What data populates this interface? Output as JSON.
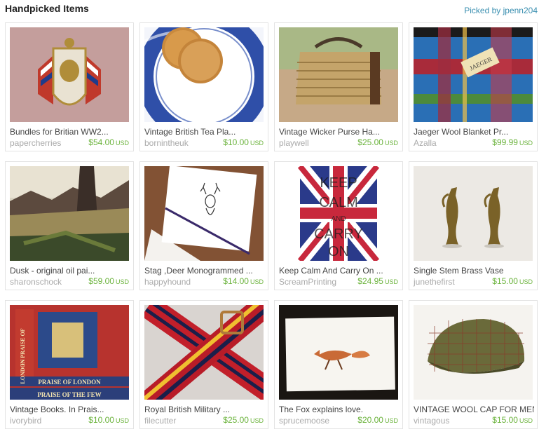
{
  "header": {
    "title": "Handpicked Items",
    "picked_by": "Picked by jpenn204"
  },
  "items": [
    {
      "title": "Bundles for Britian WW2...",
      "seller": "papercherries",
      "price": "$54.00",
      "currency": "USD",
      "image": "lion-crest-brooch"
    },
    {
      "title": "Vintage British Tea Pla...",
      "seller": "bornintheuk",
      "price": "$10.00",
      "currency": "USD",
      "image": "blue-willow-plate-biscuits"
    },
    {
      "title": "Vintage Wicker Purse Ha...",
      "seller": "playwell",
      "price": "$25.00",
      "currency": "USD",
      "image": "wicker-purse"
    },
    {
      "title": "Jaeger Wool Blanket Pr...",
      "seller": "Azalla",
      "price": "$99.99",
      "currency": "USD",
      "image": "plaid-wool-blanket"
    },
    {
      "title": "Dusk - original oil pai...",
      "seller": "sharonschock",
      "price": "$59.00",
      "currency": "USD",
      "image": "oil-painting-landscape"
    },
    {
      "title": "Stag ,Deer Monogrammed ...",
      "seller": "happyhound",
      "price": "$14.00",
      "currency": "USD",
      "image": "stag-stationery"
    },
    {
      "title": "Keep Calm And Carry On ...",
      "seller": "ScreamPrinting",
      "price": "$24.95",
      "currency": "USD",
      "image": "keep-calm-union-jack",
      "poster_lines": [
        "KEEP",
        "CALM",
        "AND",
        "CARRY",
        "ON"
      ]
    },
    {
      "title": "Single Stem Brass Vase",
      "seller": "junethefirst",
      "price": "$15.00",
      "currency": "USD",
      "image": "brass-vases"
    },
    {
      "title": "Vintage Books. In Prais...",
      "seller": "ivorybird",
      "price": "$10.00",
      "currency": "USD",
      "image": "in-praise-of-london-books",
      "book_lines": [
        "IN PRAISE OF",
        "LONDON",
        "PRAISE OF LONDON",
        "PRAISE OF THE FEW"
      ]
    },
    {
      "title": "Royal British Military ...",
      "seller": "filecutter",
      "price": "$25.00",
      "currency": "USD",
      "image": "striped-belts"
    },
    {
      "title": "The Fox explains love.",
      "seller": "sprucemoose",
      "price": "$20.00",
      "currency": "USD",
      "image": "fox-card"
    },
    {
      "title": "VINTAGE WOOL CAP FOR MEN",
      "seller": "vintagous",
      "price": "$15.00",
      "currency": "USD",
      "image": "tweed-flat-cap"
    }
  ],
  "colors": {
    "price": "#6bb33c",
    "link": "#3a8fb0",
    "seller": "#aaaaaa"
  }
}
